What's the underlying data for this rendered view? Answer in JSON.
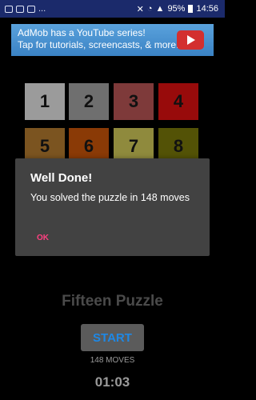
{
  "status_bar": {
    "icons": [
      "image-icon",
      "image-icon",
      "email-icon",
      "more-icon",
      "mute-icon",
      "wifi-icon",
      "signal-icon"
    ],
    "overflow_label": "...",
    "battery": "95%",
    "time": "14:56"
  },
  "ad": {
    "line1": "AdMob has a YouTube series!",
    "line2": "Tap for tutorials, screencasts, & more."
  },
  "tiles": [
    {
      "label": "1",
      "color": "#9b9b9b"
    },
    {
      "label": "2",
      "color": "#6f6f6f"
    },
    {
      "label": "3",
      "color": "#7e3a3a"
    },
    {
      "label": "4",
      "color": "#980b0b"
    },
    {
      "label": "5",
      "color": "#7b5420"
    },
    {
      "label": "6",
      "color": "#8a3a06"
    },
    {
      "label": "7",
      "color": "#8f8a3d"
    },
    {
      "label": "8",
      "color": "#535206"
    }
  ],
  "dialog": {
    "title": "Well Done!",
    "message": "You solved the puzzle in 148 moves",
    "ok_label": "OK"
  },
  "app_title": "Fifteen Puzzle",
  "start_label": "START",
  "moves_label": "148 MOVES",
  "timer": "01:03"
}
